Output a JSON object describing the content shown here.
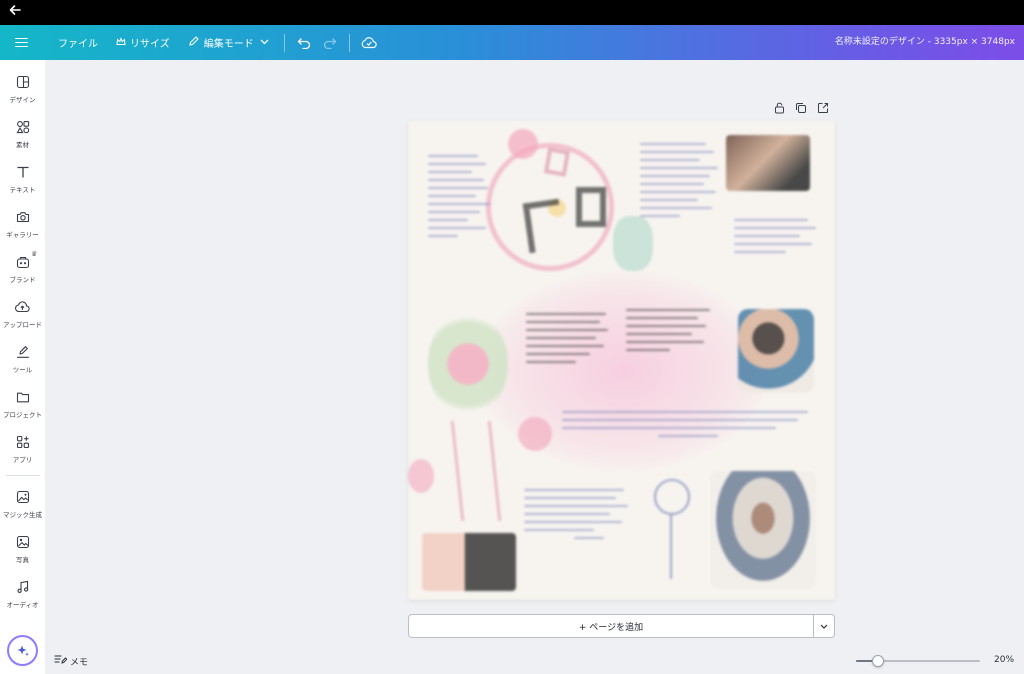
{
  "os": {
    "back_icon": "back-arrow-icon"
  },
  "header": {
    "menu_icon": "hamburger-icon",
    "file_label": "ファイル",
    "resize_label": "リサイズ",
    "resize_icon": "crown-icon",
    "edit_mode_label": "編集モード",
    "edit_mode_icon": "pencil-icon",
    "undo_icon": "undo-icon",
    "redo_icon": "redo-icon",
    "cloud_icon": "cloud-check-icon",
    "document_title": "名称未設定のデザイン - 3335px × 3748px"
  },
  "sidebar": {
    "items": [
      {
        "label": "デザイン",
        "icon": "layout-icon"
      },
      {
        "label": "素材",
        "icon": "shapes-icon"
      },
      {
        "label": "テキスト",
        "icon": "text-icon"
      },
      {
        "label": "ギャラリー",
        "icon": "camera-icon"
      },
      {
        "label": "ブランド",
        "icon": "brand-icon"
      },
      {
        "label": "アップロード",
        "icon": "cloud-upload-icon"
      },
      {
        "label": "ツール",
        "icon": "draw-tool-icon"
      },
      {
        "label": "プロジェクト",
        "icon": "folder-icon"
      },
      {
        "label": "アプリ",
        "icon": "apps-icon"
      },
      {
        "label": "マジック生成",
        "icon": "magic-image-icon"
      },
      {
        "label": "写真",
        "icon": "photo-icon"
      },
      {
        "label": "オーディオ",
        "icon": "music-icon"
      }
    ],
    "assistant_icon": "sparkle-icon"
  },
  "page_tools": [
    "lock-icon",
    "duplicate-icon",
    "share-page-icon"
  ],
  "canvas": {
    "add_page_label": "+ ページを追加",
    "expand_icon": "chevron-down-icon"
  },
  "footer": {
    "memo_label": "メモ",
    "memo_icon": "notes-icon",
    "zoom_percent": 20,
    "zoom_label": "20%"
  },
  "colors": {
    "header_gradient_start": "#14b7c8",
    "header_gradient_end": "#7d4de8",
    "canvas_bg": "#eef0f3",
    "assistant_ring": "#8f7bff"
  }
}
